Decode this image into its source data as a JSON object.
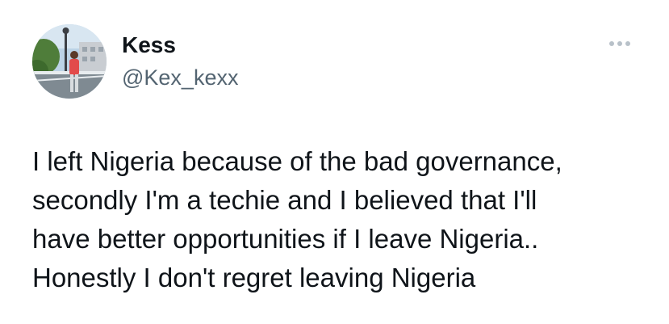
{
  "author": {
    "display_name": "Kess",
    "handle": "@Kex_kexx",
    "avatar_icon": "profile-photo-avatar"
  },
  "menu": {
    "icon": "more-options-icon"
  },
  "tweet": {
    "text": "I left Nigeria because of the bad governance,\nsecondly I'm a techie and I believed that I'll\nhave better opportunities if I leave Nigeria..\nHonestly I don't regret leaving Nigeria"
  },
  "colors": {
    "text_primary": "#0f1419",
    "text_secondary": "#536471",
    "icon_muted": "#b8c1c9",
    "background": "#ffffff"
  }
}
